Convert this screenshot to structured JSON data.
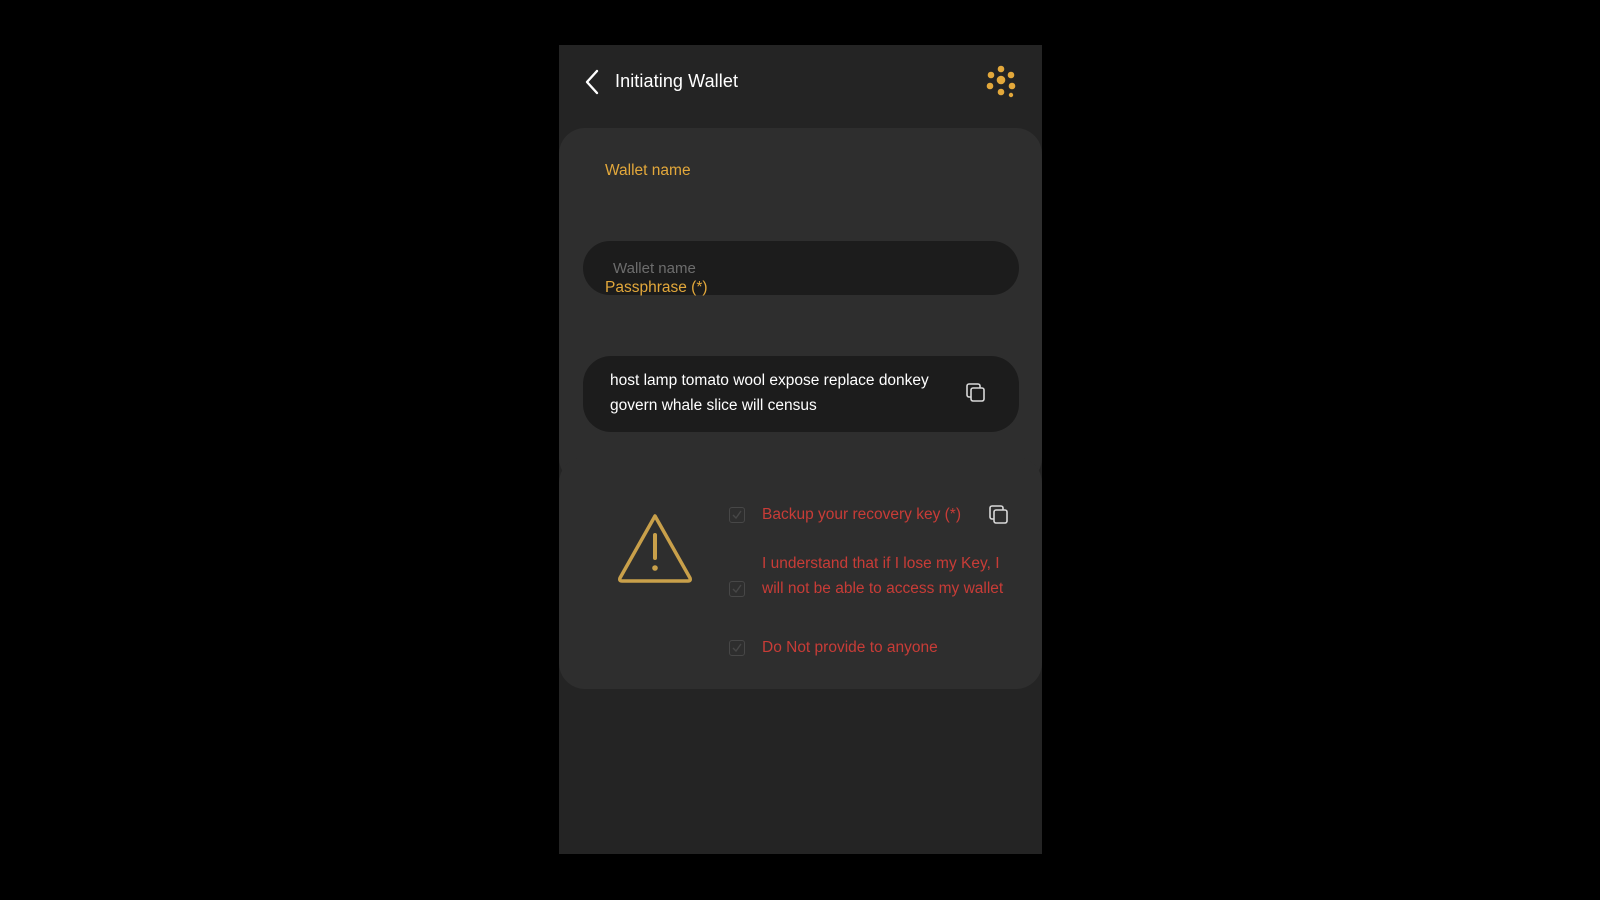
{
  "header": {
    "title": "Initiating Wallet",
    "accent_color": "#e3a83b"
  },
  "form": {
    "wallet_name": {
      "label": "Wallet name",
      "placeholder": "Wallet name",
      "value": ""
    },
    "passphrase": {
      "label": "Passphrase (*)",
      "value": "host lamp tomato wool expose replace donkey govern whale slice will census",
      "copy_icon": "copy-icon"
    }
  },
  "warning": {
    "icon": "warning-triangle-icon",
    "checklist": [
      {
        "label": "Backup your recovery key (*)",
        "checked": false,
        "copy_icon": "copy-icon"
      },
      {
        "label": "I understand that if I lose my Key, I will not be able to access my wallet",
        "checked": false
      },
      {
        "label": "Do Not provide to anyone",
        "checked": false
      }
    ],
    "text_color": "#c83c37"
  }
}
